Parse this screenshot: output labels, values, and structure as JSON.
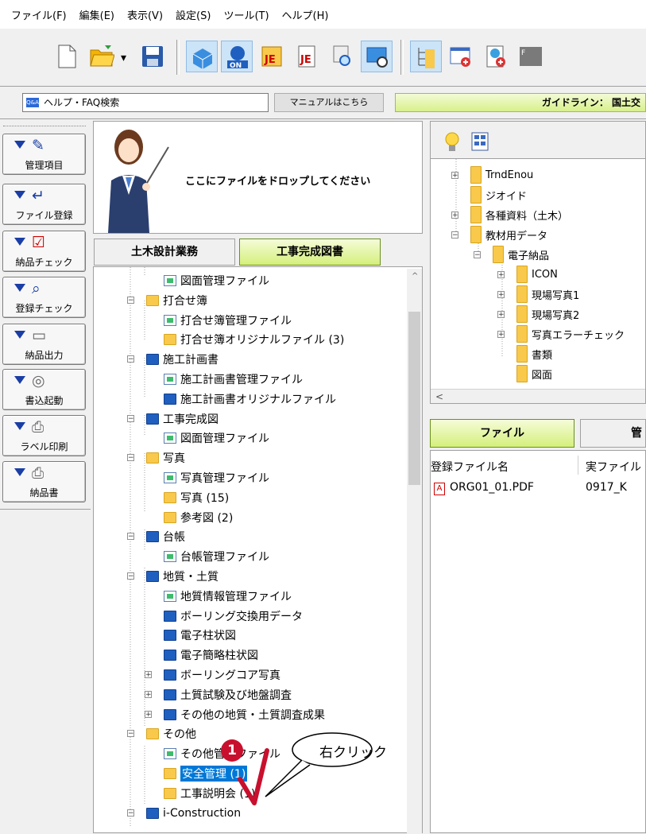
{
  "menu": [
    "ファイル(F)",
    "編集(E)",
    "表示(V)",
    "設定(S)",
    "ツール(T)",
    "ヘルプ(H)"
  ],
  "help_bar": {
    "search_label": "ヘルプ・FAQ検索",
    "qa_icon_text": "Q&A",
    "manual_button": "マニュアルはこちら",
    "guideline": "ガイドライン： 国土交"
  },
  "side_buttons": [
    "管理項目",
    "ファイル登録",
    "納品チェック",
    "登録チェック",
    "納品出力",
    "書込起動",
    "ラベル印刷",
    "納品書"
  ],
  "drop_area": {
    "text": "ここにファイルをドロップしてください"
  },
  "tabs": {
    "civil": "土木設計業務",
    "complete": "工事完成図書"
  },
  "left_tree": [
    {
      "label": "図面管理ファイル",
      "icon": "doc",
      "level": 2
    },
    {
      "label": "打合せ簿",
      "icon": "folder-yellow",
      "level": 1,
      "exp": "−"
    },
    {
      "label": "打合せ簿管理ファイル",
      "icon": "doc",
      "level": 2
    },
    {
      "label": "打合せ簿オリジナルファイル (3)",
      "icon": "folder-yellow",
      "level": 2
    },
    {
      "label": "施工計画書",
      "icon": "folder-blue",
      "level": 1,
      "exp": "−"
    },
    {
      "label": "施工計画書管理ファイル",
      "icon": "doc",
      "level": 2
    },
    {
      "label": "施工計画書オリジナルファイル",
      "icon": "folder-blue",
      "level": 2
    },
    {
      "label": "工事完成図",
      "icon": "folder-blue",
      "level": 1,
      "exp": "−"
    },
    {
      "label": "図面管理ファイル",
      "icon": "doc",
      "level": 2
    },
    {
      "label": "写真",
      "icon": "folder-yellow",
      "level": 1,
      "exp": "−"
    },
    {
      "label": "写真管理ファイル",
      "icon": "doc",
      "level": 2
    },
    {
      "label": "写真 (15)",
      "icon": "folder-yellow",
      "level": 2
    },
    {
      "label": "参考図 (2)",
      "icon": "folder-yellow",
      "level": 2
    },
    {
      "label": "台帳",
      "icon": "folder-blue",
      "level": 1,
      "exp": "−"
    },
    {
      "label": "台帳管理ファイル",
      "icon": "doc",
      "level": 2
    },
    {
      "label": "地質・土質",
      "icon": "folder-blue",
      "level": 1,
      "exp": "−"
    },
    {
      "label": "地質情報管理ファイル",
      "icon": "doc",
      "level": 2
    },
    {
      "label": "ボーリング交換用データ",
      "icon": "folder-blue",
      "level": 2
    },
    {
      "label": "電子柱状図",
      "icon": "folder-blue",
      "level": 2
    },
    {
      "label": "電子簡略柱状図",
      "icon": "folder-blue",
      "level": 2
    },
    {
      "label": "ボーリングコア写真",
      "icon": "folder-blue",
      "level": 2,
      "exp": "+"
    },
    {
      "label": "土質試験及び地盤調査",
      "icon": "folder-blue",
      "level": 2,
      "exp": "+"
    },
    {
      "label": "その他の地質・土質調査成果",
      "icon": "folder-blue",
      "level": 2,
      "exp": "+"
    },
    {
      "label": "その他",
      "icon": "folder-yellow",
      "level": 1,
      "exp": "−"
    },
    {
      "label": "その他管理ファイル",
      "icon": "doc",
      "level": 2
    },
    {
      "label": "安全管理 (1)",
      "icon": "folder-yellow",
      "level": 2,
      "selected": true
    },
    {
      "label": "工事説明会 (1)",
      "icon": "folder-yellow",
      "level": 2
    },
    {
      "label": "i-Construction",
      "icon": "folder-blue",
      "level": 1,
      "exp": "−"
    }
  ],
  "right_tree": [
    {
      "label": "TrndEnou",
      "level": 0,
      "exp": "+"
    },
    {
      "label": "ジオイド",
      "level": 0
    },
    {
      "label": "各種資料（土木）",
      "level": 0,
      "exp": "+"
    },
    {
      "label": "教材用データ",
      "level": 0,
      "exp": "−"
    },
    {
      "label": "電子納品",
      "level": 1,
      "exp": "−"
    },
    {
      "label": "ICON",
      "level": 2,
      "exp": "+"
    },
    {
      "label": "現場写真1",
      "level": 2,
      "exp": "+"
    },
    {
      "label": "現場写真2",
      "level": 2,
      "exp": "+"
    },
    {
      "label": "写真エラーチェック",
      "level": 2,
      "exp": "+"
    },
    {
      "label": "書類",
      "level": 2
    },
    {
      "label": "図面",
      "level": 2
    }
  ],
  "right_tabs": {
    "file": "ファイル",
    "kanri": "管"
  },
  "file_list": {
    "columns": [
      "登録ファイル名",
      "実ファイル"
    ],
    "rows": [
      {
        "name": "ORG01_01.PDF",
        "real": "0917_K"
      }
    ]
  },
  "callout": {
    "number": "1",
    "text": "右クリック"
  },
  "colors": {
    "accent_green": "#d5ef7c",
    "selection_blue": "#0078d7",
    "badge_red": "#c8102e"
  }
}
